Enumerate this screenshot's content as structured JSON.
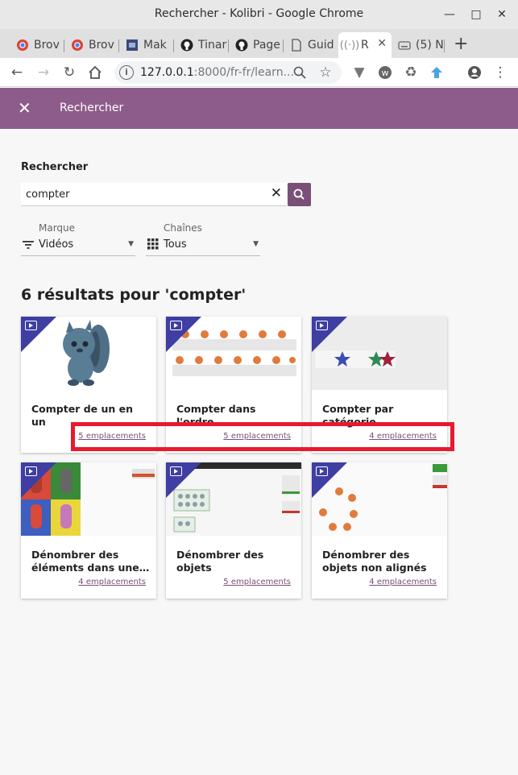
{
  "window": {
    "title": "Rechercher - Kolibri - Google Chrome"
  },
  "tabs": [
    {
      "label": "Brov",
      "icon": "chrome-icon"
    },
    {
      "label": "Brov",
      "icon": "chrome-icon"
    },
    {
      "label": "Mak",
      "icon": "image-icon"
    },
    {
      "label": "Tinar",
      "icon": "github-icon"
    },
    {
      "label": "Page",
      "icon": "github-icon"
    },
    {
      "label": "Guid",
      "icon": "document-icon"
    },
    {
      "label": "R",
      "icon": "broadcast-icon"
    },
    {
      "label": "(5) N",
      "icon": "keyboard-icon"
    }
  ],
  "omnibox": {
    "host": "127.0.0.1",
    "rest": ":8000/fr-fr/learn..."
  },
  "appbar": {
    "title": "Rechercher"
  },
  "search": {
    "label": "Rechercher",
    "value": "compter"
  },
  "filters": {
    "kind": {
      "label": "Marque",
      "value": "Vidéos"
    },
    "channel": {
      "label": "Chaînes",
      "value": "Tous"
    }
  },
  "results": {
    "title": "6 résultats pour 'compter'",
    "cards": [
      {
        "title": "Compter de un en un",
        "link": "5 emplacements"
      },
      {
        "title": "Compter dans l'ordre",
        "link": "5 emplacements"
      },
      {
        "title": "Compter par catégorie",
        "link": "4 emplacements"
      },
      {
        "title": "Dénombrer des éléments dans une…",
        "link": "4 emplacements"
      },
      {
        "title": "Dénombrer des objets",
        "link": "5 emplacements"
      },
      {
        "title": "Dénombrer des objets non alignés",
        "link": "4 emplacements"
      }
    ]
  },
  "colors": {
    "brand": "#8e5c8b",
    "accent": "#7a4f78",
    "badge": "#3f3ea3",
    "highlight": "#e8192c"
  }
}
